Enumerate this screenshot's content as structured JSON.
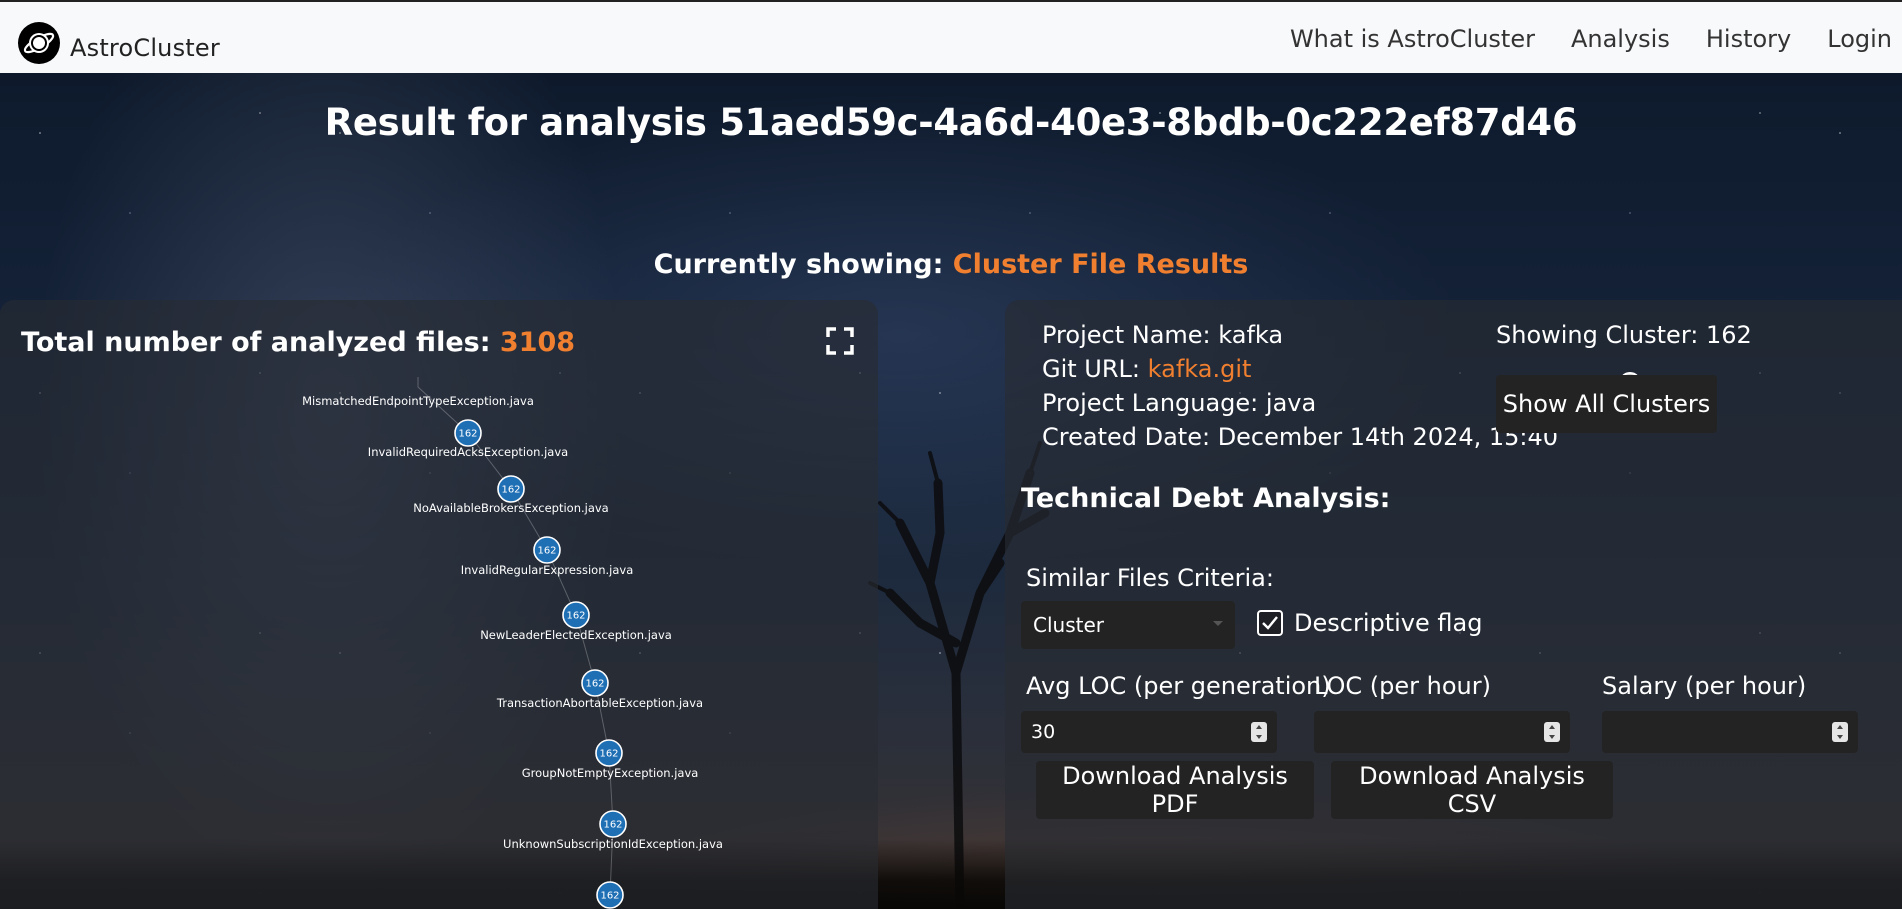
{
  "navbar": {
    "brand": "AstroCluster",
    "links": [
      "What is AstroCluster",
      "Analysis",
      "History",
      "Login"
    ]
  },
  "page": {
    "title": "Result for analysis 51aed59c-4a6d-40e3-8bdb-0c222ef87d46",
    "showing_prefix": "Currently showing: ",
    "showing_value": "Cluster File Results"
  },
  "left_panel": {
    "total_label": "Total number of analyzed files: ",
    "total_value": "3108",
    "nodes": [
      {
        "label": "MismatchedEndpointTypeException.java",
        "badge": null
      },
      {
        "label": "InvalidRequiredAcksException.java",
        "badge": "162"
      },
      {
        "label": "NoAvailableBrokersException.java",
        "badge": "162"
      },
      {
        "label": "InvalidRegularExpression.java",
        "badge": "162"
      },
      {
        "label": "NewLeaderElectedException.java",
        "badge": "162"
      },
      {
        "label": "TransactionAbortableException.java",
        "badge": "162"
      },
      {
        "label": "GroupNotEmptyException.java",
        "badge": "162"
      },
      {
        "label": "UnknownSubscriptionIdException.java",
        "badge": "162"
      },
      {
        "label": "",
        "badge": "162"
      }
    ]
  },
  "project": {
    "name_label": "Project Name: ",
    "name": "kafka",
    "git_label": "Git URL: ",
    "git": "kafka.git",
    "language_label": "Project Language: ",
    "language": "java",
    "created_label": "Created Date: ",
    "created": "December 14th 2024, 15:40"
  },
  "cluster": {
    "label": "Showing Cluster: 162",
    "slider_fraction": 0.72,
    "show_all_label": "Show All Clusters"
  },
  "tda": {
    "heading": "Technical Debt Analysis:",
    "criteria_label": "Similar Files Criteria:",
    "criteria_value": "Cluster",
    "descriptive_flag_label": "Descriptive flag",
    "descriptive_flag_checked": true,
    "avg_loc_label": "Avg LOC (per generation)",
    "avg_loc_value": "30",
    "loc_per_hour_label": "LOC (per hour)",
    "loc_per_hour_value": "",
    "salary_label": "Salary (per hour)",
    "salary_value": "",
    "download_pdf_label": "Download Analysis PDF",
    "download_csv_label": "Download Analysis CSV"
  },
  "colors": {
    "accent": "#f07f2f",
    "node_fill": "#1f6fb5",
    "panel": "#2c3036",
    "button": "#232323"
  }
}
